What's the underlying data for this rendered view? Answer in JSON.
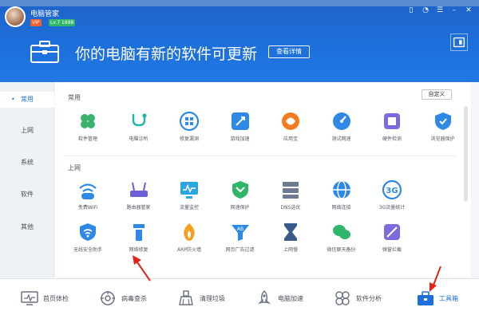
{
  "window": {
    "app_name": "电脑管家",
    "vip_badge": "VIP",
    "level_badge": "Lv.7 1888"
  },
  "controls": {
    "phone_icon": "phone-icon",
    "skin_icon": "skin-icon",
    "menu_icon": "menu-icon",
    "minimize_icon": "minimize-icon",
    "close_icon": "close-icon"
  },
  "banner": {
    "headline": "你的电脑有新的软件可更新",
    "details_label": "查看详情"
  },
  "sidebar": {
    "items": [
      {
        "label": "常用"
      },
      {
        "label": "上网"
      },
      {
        "label": "系统"
      },
      {
        "label": "软件"
      },
      {
        "label": "其他"
      }
    ]
  },
  "sections": {
    "common_title": "常用",
    "internet_title": "上网",
    "customize_label": "自定义"
  },
  "tools_common": [
    {
      "label": "软件管理",
      "icon": "software-manager-icon",
      "color": "#3bb26b"
    },
    {
      "label": "电脑诊所",
      "icon": "pc-clinic-icon",
      "color": "#1fb5a4"
    },
    {
      "label": "修复漏洞",
      "icon": "vulnerability-fix-icon",
      "color": "#2d88e6"
    },
    {
      "label": "游戏加速",
      "icon": "game-boost-icon",
      "color": "#2d88e6"
    },
    {
      "label": "应用宝",
      "icon": "app-store-icon",
      "color": "#f37a1f"
    },
    {
      "label": "测试网速",
      "icon": "speed-test-icon",
      "color": "#2d88e6"
    },
    {
      "label": "硬件检测",
      "icon": "hardware-check-icon",
      "color": "#7d6adf"
    },
    {
      "label": "浏览器保护",
      "icon": "browser-protect-icon",
      "color": "#2d88e6"
    }
  ],
  "tools_internet_row1": [
    {
      "label": "免费WiFi",
      "icon": "free-wifi-icon",
      "color": "#2d88e6"
    },
    {
      "label": "路由器管家",
      "icon": "router-icon",
      "color": "#6a5fd9"
    },
    {
      "label": "流量监控",
      "icon": "traffic-monitor-icon",
      "color": "#2aa6df"
    },
    {
      "label": "网速保护",
      "icon": "speed-protect-icon",
      "color": "#2fb66a"
    },
    {
      "label": "DNS选优",
      "icon": "dns-icon",
      "color": "#6c7a92"
    },
    {
      "label": "网络连接",
      "icon": "network-icon",
      "color": "#2d88e6"
    },
    {
      "label": "3G流量统计",
      "icon": "3g-traffic-icon",
      "color": "#2d88e6"
    }
  ],
  "tools_internet_row2": [
    {
      "label": "无线安全助手",
      "icon": "wifi-security-icon",
      "color": "#2d88e6"
    },
    {
      "label": "网络修复",
      "icon": "network-repair-icon",
      "color": "#2d88e6"
    },
    {
      "label": "ARP防火墙",
      "icon": "arp-firewall-icon",
      "color": "#f3a11f"
    },
    {
      "label": "网页广告过滤",
      "icon": "ad-filter-icon",
      "color": "#2d88e6"
    },
    {
      "label": "上网慢",
      "icon": "slow-internet-icon",
      "color": "#3a5a8c"
    },
    {
      "label": "微信聊天备份",
      "icon": "wechat-backup-icon",
      "color": "#2fb66a"
    },
    {
      "label": "弹窗拦截",
      "icon": "popup-block-icon",
      "color": "#7d6adf"
    }
  ],
  "bottom_tabs": [
    {
      "label": "首页体检",
      "icon": "monitor-icon"
    },
    {
      "label": "病毒查杀",
      "icon": "virus-scan-icon"
    },
    {
      "label": "清理垃圾",
      "icon": "broom-icon"
    },
    {
      "label": "电脑加速",
      "icon": "rocket-icon"
    },
    {
      "label": "软件分析",
      "icon": "software-analysis-icon"
    },
    {
      "label": "工具箱",
      "icon": "toolbox-icon"
    }
  ],
  "colors": {
    "accent": "#1d6fdb",
    "annotation_arrow": "#e2231a"
  }
}
